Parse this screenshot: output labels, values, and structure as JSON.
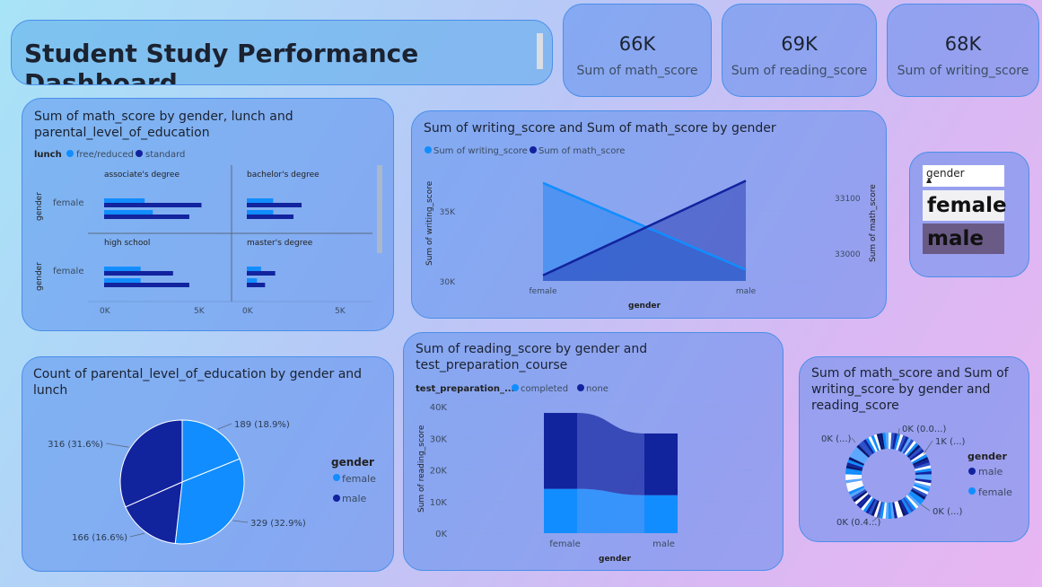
{
  "title": "Student Study Performance Dashboard",
  "kpis": [
    {
      "value": "66K",
      "label": "Sum of math_score"
    },
    {
      "value": "69K",
      "label": "Sum of reading_score"
    },
    {
      "value": "68K",
      "label": "Sum of writing_score"
    }
  ],
  "slicer": {
    "header": "gender",
    "items": [
      "female",
      "male"
    ]
  },
  "colors": {
    "light": "#118dff",
    "dark": "#12239e"
  },
  "chart_data": [
    {
      "id": "bar",
      "type": "bar",
      "title": "Sum of math_score by gender, lunch and parental_level_of_education",
      "legend_title": "lunch",
      "legend": [
        "free/reduced",
        "standard"
      ],
      "ylabel": "gender",
      "xlim": [
        0,
        5000
      ],
      "ticks": [
        "0K",
        "5K"
      ],
      "panels": [
        {
          "label": "associate's degree",
          "category": "female",
          "values": [
            2000,
            4800,
            2400,
            4200
          ]
        },
        {
          "label": "bachelor's degree",
          "category": "female",
          "values": [
            1300,
            2700,
            1300,
            2300
          ]
        },
        {
          "label": "high school",
          "category": "female",
          "values": [
            1800,
            3400,
            1800,
            4200
          ]
        },
        {
          "label": "master's degree",
          "category": "female",
          "values": [
            700,
            1400,
            500,
            900
          ]
        }
      ]
    },
    {
      "id": "line",
      "type": "area",
      "title": "Sum of writing_score and Sum of math_score by gender",
      "categories": [
        "female",
        "male"
      ],
      "series": [
        {
          "name": "Sum of writing_score",
          "values": [
            37000,
            30800
          ]
        },
        {
          "name": "Sum of math_score",
          "values": [
            32960,
            33130
          ]
        }
      ],
      "xlabel": "gender",
      "ylabel": "Sum of writing_score",
      "y2label": "Sum of math_score",
      "yticks": [
        "30K",
        "35K"
      ],
      "y2ticks": [
        "33000",
        "33100"
      ]
    },
    {
      "id": "pie",
      "type": "pie",
      "title": "Count of parental_level_of_education by gender and lunch",
      "legend_title": "gender",
      "legend": [
        "female",
        "male"
      ],
      "slices": [
        {
          "label": "189 (18.9%)",
          "value": 189,
          "group": "female"
        },
        {
          "label": "329 (32.9%)",
          "value": 329,
          "group": "female"
        },
        {
          "label": "166 (16.6%)",
          "value": 166,
          "group": "male"
        },
        {
          "label": "316 (31.6%)",
          "value": 316,
          "group": "male"
        }
      ]
    },
    {
      "id": "ribbon",
      "type": "bar",
      "title": "Sum of reading_score by gender and test_preparation_course",
      "legend_title": "test_preparation_...",
      "legend": [
        "completed",
        "none"
      ],
      "categories": [
        "female",
        "male"
      ],
      "series": [
        {
          "name": "completed",
          "values": [
            14000,
            12000
          ]
        },
        {
          "name": "none",
          "values": [
            24000,
            19500
          ]
        }
      ],
      "ylim": [
        0,
        40000
      ],
      "yticks": [
        "0K",
        "10K",
        "20K",
        "30K",
        "40K"
      ],
      "xlabel": "gender",
      "ylabel": "Sum of reading_score"
    },
    {
      "id": "donut",
      "type": "pie",
      "title": "Sum of math_score and Sum of writing_score by gender and reading_score",
      "legend_title": "gender",
      "legend": [
        "male",
        "female"
      ],
      "labels": [
        "0K (0.0...)",
        "1K (...)",
        "0K (...)",
        "0K (0.4...)",
        "0K (...)"
      ]
    }
  ]
}
